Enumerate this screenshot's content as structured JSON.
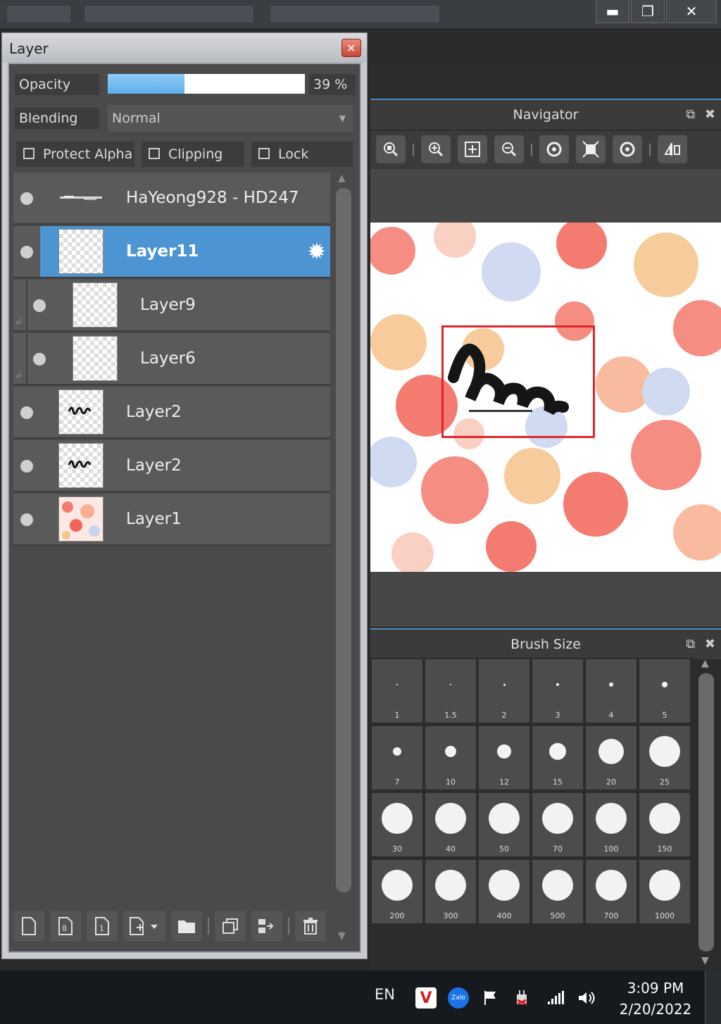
{
  "window": {
    "controls": {
      "minimize": "▬",
      "maximize": "❐",
      "close": "✕"
    }
  },
  "layer_panel": {
    "title": "Layer",
    "close_glyph": "✕",
    "opacity": {
      "label": "Opacity",
      "value": 39,
      "value_text": "39 %"
    },
    "blending": {
      "label": "Blending",
      "value": "Normal"
    },
    "checkboxes": [
      {
        "label": "Protect Alpha",
        "checked": false
      },
      {
        "label": "Clipping",
        "checked": false
      },
      {
        "label": "Lock",
        "checked": false
      }
    ],
    "layers": [
      {
        "name": "HaYeong928 - HD247",
        "selected": false,
        "clipped": false,
        "thumb": "text-strip"
      },
      {
        "name": "Layer11",
        "selected": true,
        "clipped": false,
        "thumb": "blank"
      },
      {
        "name": "Layer9",
        "selected": false,
        "clipped": true,
        "thumb": "blank"
      },
      {
        "name": "Layer6",
        "selected": false,
        "clipped": true,
        "thumb": "blank"
      },
      {
        "name": "Layer2",
        "selected": false,
        "clipped": false,
        "thumb": "logo"
      },
      {
        "name": "Layer2",
        "selected": false,
        "clipped": false,
        "thumb": "logo"
      },
      {
        "name": "Layer1",
        "selected": false,
        "clipped": false,
        "thumb": "splatter"
      }
    ],
    "toolbar_icons": [
      "new-layer-icon",
      "new-8bit-layer-icon",
      "new-1bit-layer-icon",
      "add-layer-menu-icon",
      "folder-icon",
      "duplicate-layer-icon",
      "merge-down-icon",
      "delete-layer-icon"
    ]
  },
  "navigator": {
    "title": "Navigator",
    "icons": [
      "zoom-fit-icon",
      "zoom-in-icon",
      "fit-window-icon",
      "zoom-out-icon",
      "rotate-left-icon",
      "reset-view-icon",
      "rotate-right-icon",
      "flip-icon"
    ]
  },
  "brush_size": {
    "title": "Brush Size",
    "sizes": [
      "1",
      "1.5",
      "2",
      "3",
      "4",
      "5",
      "7",
      "10",
      "12",
      "15",
      "20",
      "25",
      "30",
      "40",
      "50",
      "70",
      "100",
      "150",
      "200",
      "300",
      "400",
      "500",
      "700",
      "1000"
    ]
  },
  "taskbar": {
    "language": "EN",
    "time": "3:09 PM",
    "date": "2/20/2022",
    "tray_icons": [
      "vivaldi-icon",
      "zalo-icon",
      "flag-icon",
      "power-icon",
      "signal-icon",
      "volume-icon"
    ],
    "tray_labels": {
      "vivaldi": "V",
      "zalo": "Zalo"
    }
  },
  "colors": {
    "accent": "#4d94d2",
    "opacity_fill": "#5fb0ec",
    "nav_rect": "#e0262a"
  }
}
